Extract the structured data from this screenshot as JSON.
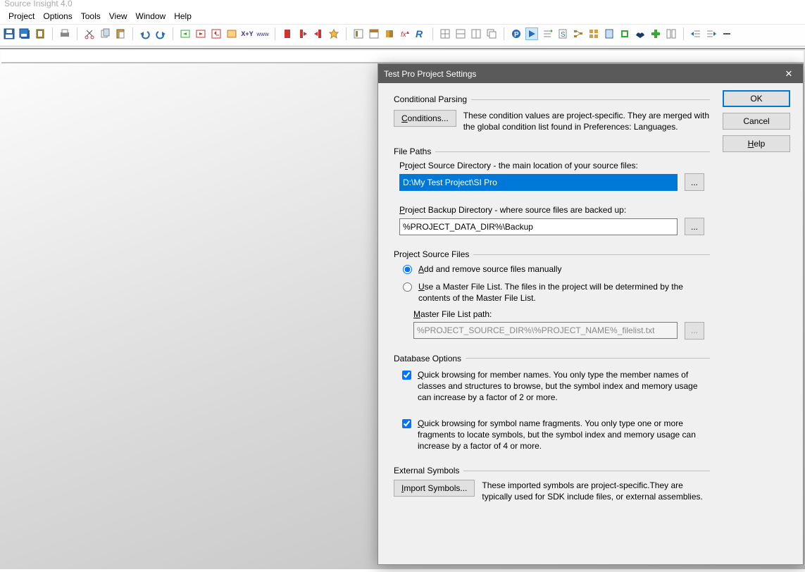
{
  "app": {
    "title": "Source Insight 4.0"
  },
  "menu": {
    "project": "Project",
    "options": "Options",
    "tools": "Tools",
    "view": "View",
    "window": "Window",
    "help": "Help"
  },
  "dialog": {
    "title": "Test Pro Project Settings",
    "buttons": {
      "ok": "OK",
      "cancel": "Cancel",
      "help": "Help"
    },
    "cond": {
      "header": "Conditional Parsing",
      "btn": "Conditions...",
      "desc": "These condition values are project-specific.  They are merged with the global condition list found in Preferences: Languages."
    },
    "paths": {
      "header": "File Paths",
      "src_label_pre": "P",
      "src_label_u": "r",
      "src_label_post": "oject Source Directory - the main location of your source files:",
      "src_value": "D:\\My Test Project\\SI Pro",
      "bak_label_pre": "",
      "bak_label_u": "P",
      "bak_label_post": "roject Backup Directory - where source files are backed up:",
      "bak_value": "%PROJECT_DATA_DIR%\\Backup",
      "browse": "..."
    },
    "psf": {
      "header": "Project Source Files",
      "opt_manual_pre": "",
      "opt_manual_u": "A",
      "opt_manual_post": "dd and remove source files manually",
      "opt_master_pre": "",
      "opt_master_u": "U",
      "opt_master_post": "se a Master File List. The files in the project will be determined by the contents of the Master File List.",
      "mfl_label_pre": "",
      "mfl_label_u": "M",
      "mfl_label_post": "aster File List path:",
      "mfl_value": "%PROJECT_SOURCE_DIR%\\%PROJECT_NAME%_filelist.txt"
    },
    "db": {
      "header": "Database Options",
      "q1_pre": "",
      "q1_u": "Q",
      "q1_post": "uick browsing for member names.  You only type the member names of classes and structures to browse, but the symbol index and memory usage can increase by a factor of 2 or more.",
      "q2_pre": "",
      "q2_u": "Q",
      "q2_post": "uick browsing for symbol name fragments.  You only type one or more fragments to locate symbols, but the symbol index and memory usage can increase by a factor of 4 or more."
    },
    "ext": {
      "header": "External Symbols",
      "btn": "Import Symbols...",
      "desc": "These imported symbols are project-specific.They are typically used for SDK include files, or external assemblies."
    }
  }
}
